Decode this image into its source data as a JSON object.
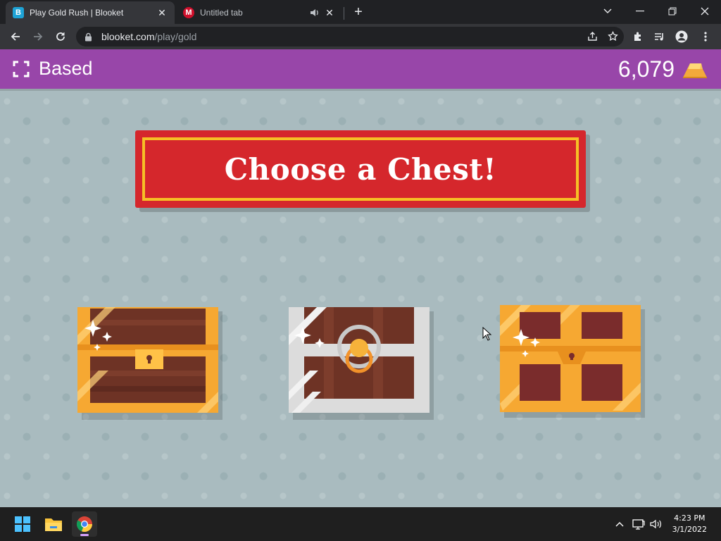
{
  "browser": {
    "tabs": [
      {
        "title": "Play Gold Rush | Blooket",
        "favicon_letter": "B",
        "favicon_color": "#1ea3d6",
        "active": true
      },
      {
        "title": "Untitled tab",
        "favicon_letter": "M",
        "favicon_color": "#d0102c",
        "active": false,
        "audio": true
      }
    ],
    "new_tab_label": "+",
    "address": {
      "domain": "blooket.com",
      "path": "/play/gold"
    }
  },
  "game": {
    "player_name": "Based",
    "gold": "6,079",
    "banner": "Choose a Chest!",
    "chests": [
      {
        "name": "wooden-chest",
        "style": "wood-gold"
      },
      {
        "name": "silver-chest",
        "style": "silver-ring"
      },
      {
        "name": "gold-chest",
        "style": "gold-red"
      }
    ],
    "colors": {
      "topbar": "#9846a9",
      "banner": "#d5272c",
      "banner_border": "#f6c026",
      "background": "#a9bbbf"
    }
  },
  "taskbar": {
    "apps": [
      "start-icon",
      "file-explorer-icon",
      "chrome-icon"
    ],
    "time": "4:23 PM",
    "date": "3/1/2022"
  }
}
